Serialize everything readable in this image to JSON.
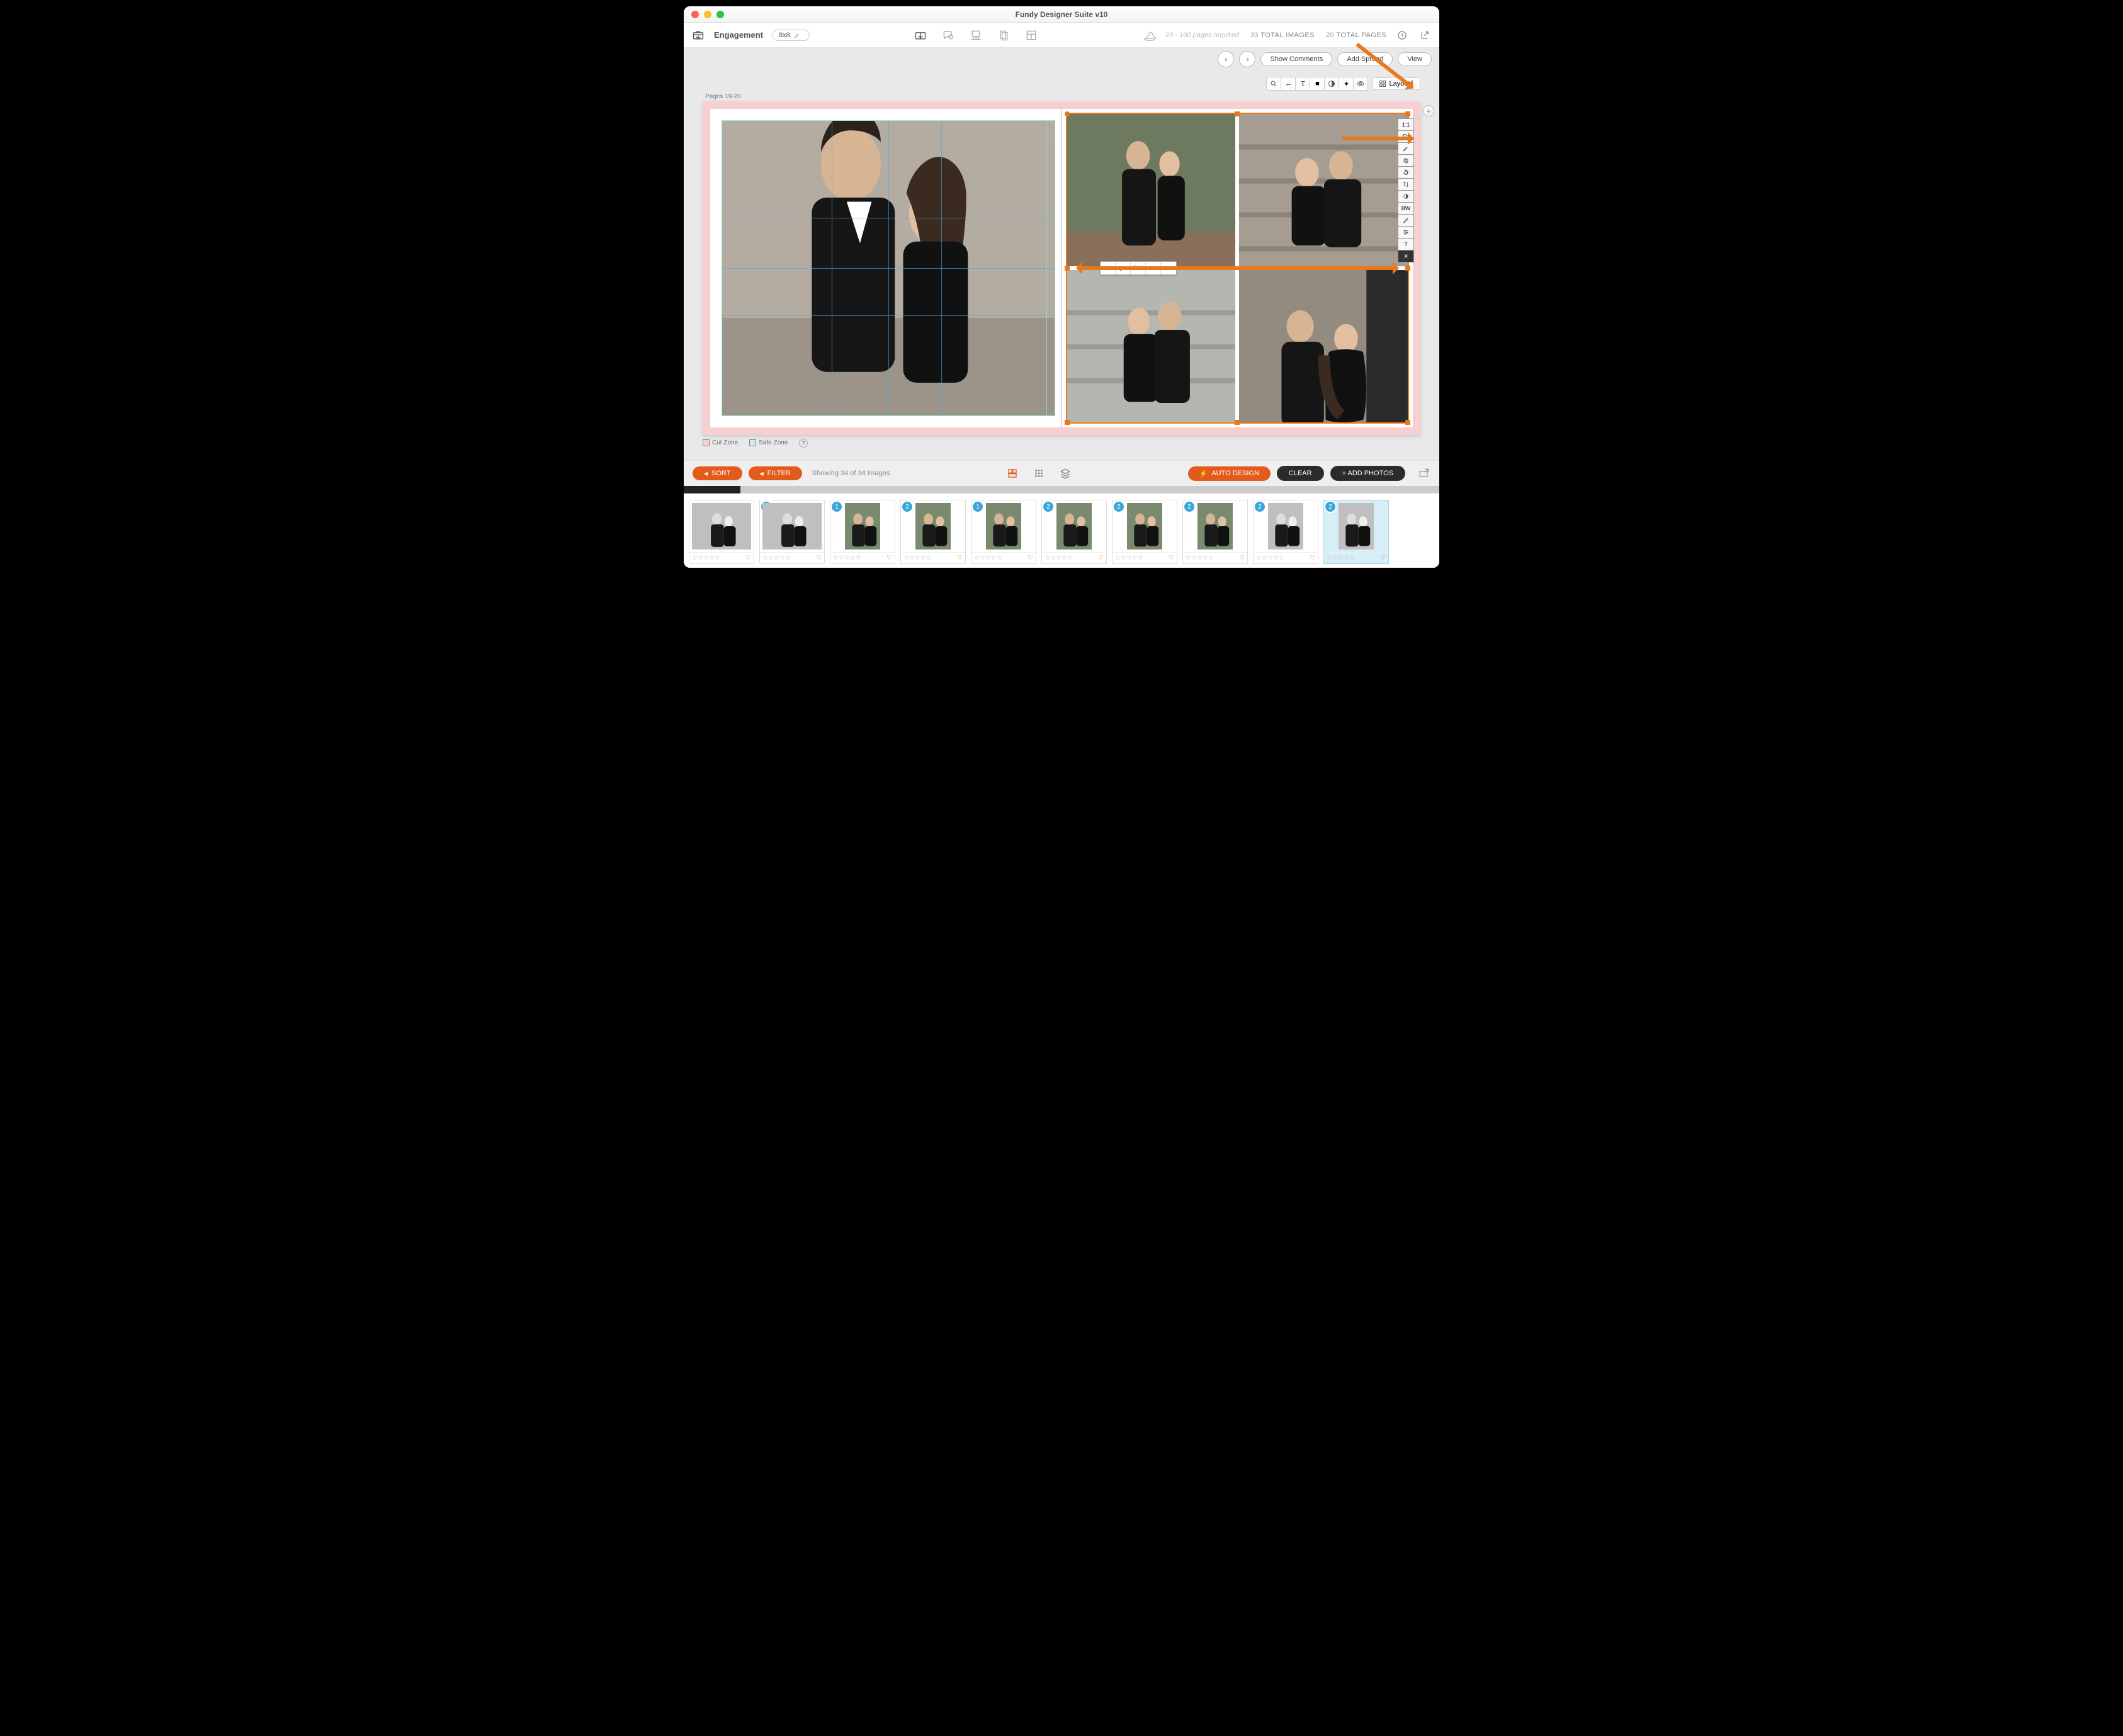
{
  "window": {
    "title": "Fundy Designer Suite v10"
  },
  "topbar": {
    "project_name": "Engagement",
    "size_pill": "8x8",
    "pages_required": "20 - 100 pages required",
    "total_images_count": "33",
    "total_images_label": "TOTAL IMAGES",
    "total_pages_count": "20",
    "total_pages_label": "TOTAL PAGES"
  },
  "subbar": {
    "show_comments": "Show Comments",
    "add_spread": "Add Spread",
    "view": "View"
  },
  "tool_row": {
    "layouts": "Layouts"
  },
  "canvas": {
    "pages_label": "Pages 19-20"
  },
  "side_tools": {
    "one_to_one": "1:1",
    "fit": "Fit",
    "bw": "BW"
  },
  "float_toolbar": {
    "one_to_one": "1:1",
    "bw": "BW"
  },
  "legend": {
    "cut": "Cut Zone",
    "safe": "Safe Zone"
  },
  "dock": {
    "sort": "SORT",
    "filter": "FILTER",
    "showing": "Showing 34 of 34 images",
    "auto_design": "AUTO DESIGN",
    "clear": "CLEAR",
    "add_photos": "+ ADD PHOTOS"
  },
  "thumbs": [
    {
      "badge": "",
      "bw": true,
      "tall": false
    },
    {
      "badge": "1",
      "bw": true,
      "tall": false
    },
    {
      "badge": "1",
      "bw": false,
      "tall": true
    },
    {
      "badge": "2",
      "bw": false,
      "tall": true
    },
    {
      "badge": "1",
      "bw": false,
      "tall": true
    },
    {
      "badge": "2",
      "bw": false,
      "tall": true
    },
    {
      "badge": "2",
      "bw": false,
      "tall": true
    },
    {
      "badge": "2",
      "bw": false,
      "tall": true
    },
    {
      "badge": "2",
      "bw": true,
      "tall": true
    },
    {
      "badge": "2",
      "bw": true,
      "tall": true,
      "selected": true
    }
  ]
}
